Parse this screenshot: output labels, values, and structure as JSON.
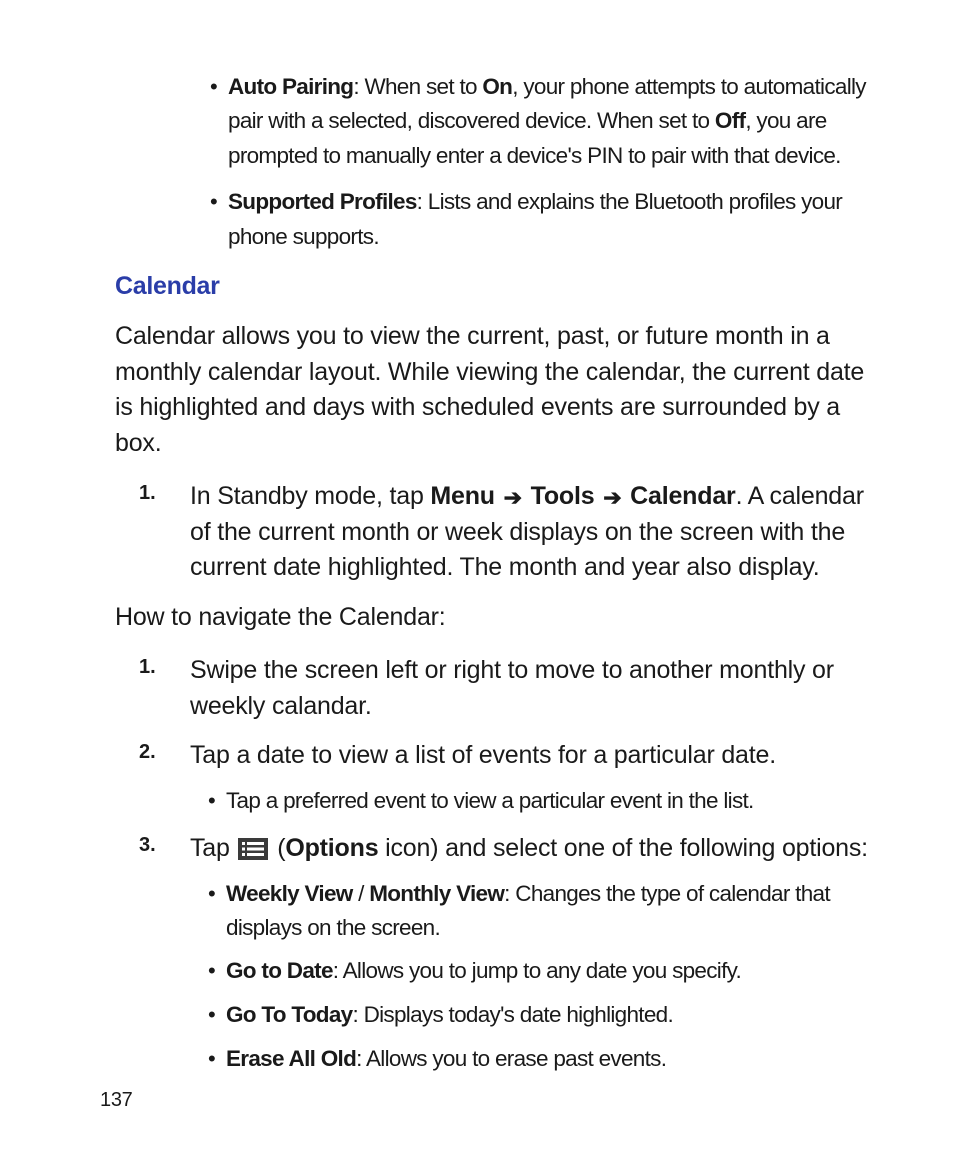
{
  "top_bullets": [
    {
      "label": "Auto Pairing",
      "pre": ": When set to ",
      "bold1": "On",
      "mid": ", your phone attempts to automatically pair with a selected, discovered device. When set to ",
      "bold2": "Off",
      "post": ", you are prompted to manually enter a device's PIN to pair with that device."
    },
    {
      "label": "Supported Profiles",
      "text": ": Lists and explains the Bluetooth profiles your phone supports."
    }
  ],
  "heading": "Calendar",
  "intro": "Calendar allows you to view the current, past, or future month in a monthly calendar layout. While viewing the calendar, the current date is highlighted and days with scheduled events are surrounded by a box.",
  "step1": {
    "num": "1.",
    "pre": "In Standby mode, tap ",
    "menu": "Menu",
    "tools": "Tools",
    "calendar": "Calendar",
    "post": ". A calendar of the current month or week displays on the screen with the current date highlighted. The month and year also display."
  },
  "nav_label": "How to navigate the Calendar:",
  "nav_steps": [
    {
      "num": "1.",
      "text": "Swipe the screen left or right to move to another monthly or weekly calandar."
    },
    {
      "num": "2.",
      "text": "Tap a date to view a list of events for a particular date."
    }
  ],
  "nav2_sub": "Tap a preferred event to view a particular event in the list.",
  "nav3": {
    "num": "3.",
    "pre": "Tap ",
    "open_paren": " (",
    "options_label": "Options",
    "post_paren": " icon) and select one of the following options:"
  },
  "opts": [
    {
      "b1": "Weekly View",
      "sep": " / ",
      "b2": "Monthly View",
      "text": ": Changes the type of calendar that displays on the screen."
    },
    {
      "b1": "Go to Date",
      "text": ": Allows you to jump to any date you specify."
    },
    {
      "b1": "Go To Today",
      "text": ": Displays today's date highlighted."
    },
    {
      "b1": "Erase All Old",
      "text": ": Allows you to erase past events."
    }
  ],
  "page_number": "137"
}
